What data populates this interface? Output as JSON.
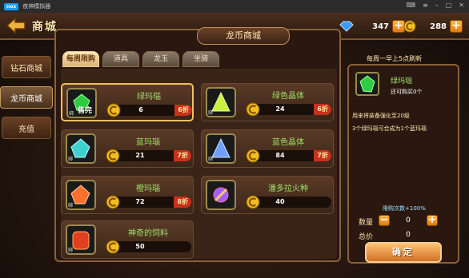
{
  "emulator": {
    "logo": "nox",
    "title": "夜神模拟器"
  },
  "header": {
    "title": "商城",
    "diamonds": "347",
    "gold": "288"
  },
  "sidebar": {
    "items": [
      {
        "label": "钻石商城"
      },
      {
        "label": "龙币商城"
      },
      {
        "label": "充值"
      }
    ]
  },
  "shop": {
    "title": "龙币商城",
    "tabs": [
      {
        "label": "每周限购"
      },
      {
        "label": "道具"
      },
      {
        "label": "龙玉"
      },
      {
        "label": "坐骑"
      }
    ],
    "items": [
      {
        "name": "绿玛瑙",
        "price": "6",
        "discount": "6折",
        "sold": "售完",
        "bind": "绑",
        "gem": "#2ecc40"
      },
      {
        "name": "绿色晶体",
        "price": "24",
        "discount": "6折",
        "bind": "绑",
        "gem": "#c8f040"
      },
      {
        "name": "蓝玛瑙",
        "price": "21",
        "discount": "7折",
        "bind": "绑",
        "gem": "#40d0d0"
      },
      {
        "name": "蓝色晶体",
        "price": "84",
        "discount": "7折",
        "bind": "绑",
        "gem": "#70a0ff"
      },
      {
        "name": "橙玛瑙",
        "price": "72",
        "discount": "8折",
        "bind": "绑",
        "gem": "#ff7030"
      },
      {
        "name": "潘多拉火种",
        "price": "40",
        "bind": "",
        "gem": "#a060ff"
      },
      {
        "name": "神奇的饲料",
        "price": "50",
        "bind": "绑",
        "gem": "#e04020"
      }
    ]
  },
  "detail": {
    "refresh_note": "每周一早上5点刷新",
    "name": "绿玛瑙",
    "stock": "还可购买0个",
    "desc1": "用来将装备强化至20级",
    "desc2": "3个绿玛瑙可合成为1个蓝玛瑙",
    "limit": "限购次数+100%",
    "qty_label": "数量",
    "qty": "0",
    "total_label": "总价",
    "total": "0",
    "confirm": "确定"
  }
}
